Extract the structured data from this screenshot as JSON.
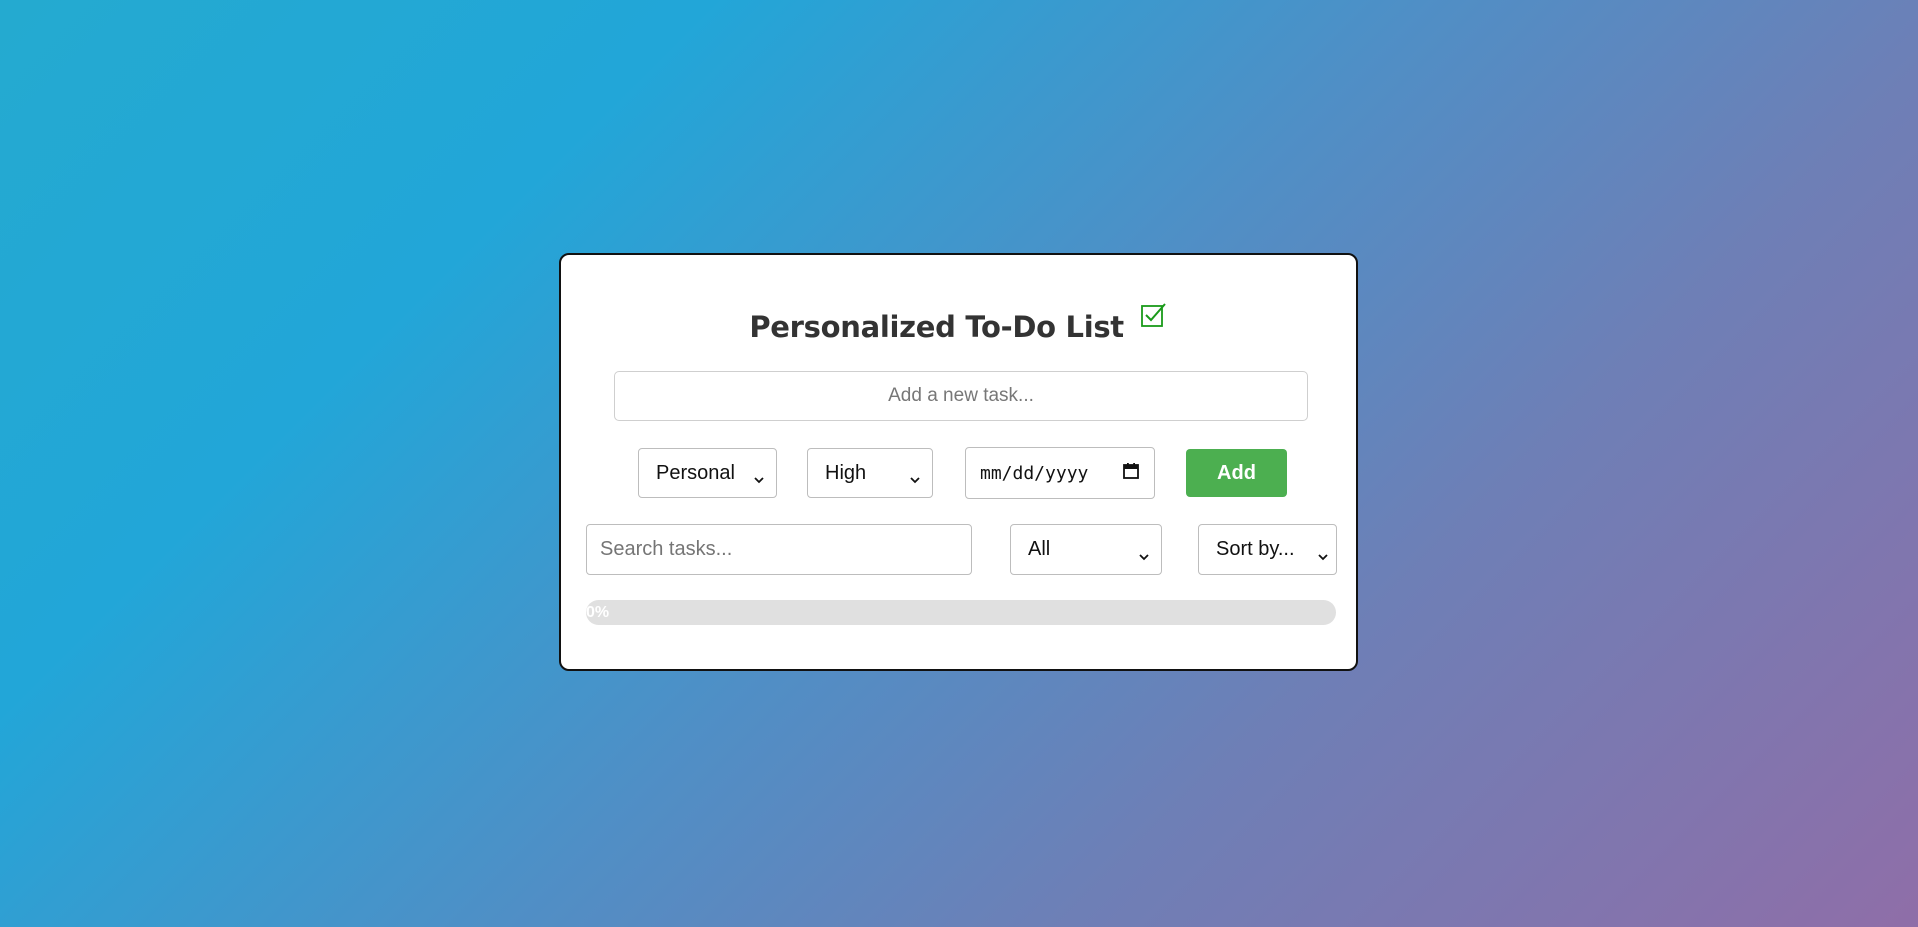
{
  "header": {
    "title": "Personalized To-Do List",
    "title_icon": "checkbox-checked-icon",
    "icon_color": "#1a9a1a"
  },
  "task_form": {
    "task_placeholder": "Add a new task...",
    "category_value": "Personal",
    "priority_value": "High",
    "date_placeholder": "mm/dd/yyyy",
    "add_label": "Add",
    "add_color": "#4caf50"
  },
  "filters": {
    "search_placeholder": "Search tasks...",
    "filter_value": "All",
    "sort_value": "Sort by..."
  },
  "progress": {
    "percent": 0,
    "label": "0%"
  }
}
